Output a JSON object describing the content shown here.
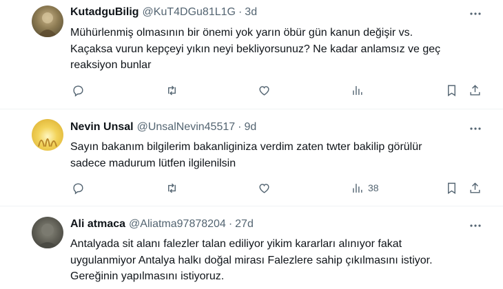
{
  "tweets": [
    {
      "name": "KutadguBilig",
      "handle": "@KuT4DGu81L1G",
      "dot": "·",
      "time": "3d",
      "lines": [
        "Mühürlenmiş olmasının bir önemi yok yarın öbür gün kanun değişir vs.",
        "Kaçaksa vurun kepçeyi yıkın neyi bekliyorsunuz? Ne kadar anlamsız ve geç",
        "reaksiyon bunlar"
      ],
      "views": ""
    },
    {
      "name": "Nevin Unsal",
      "handle": "@UnsalNevin45517",
      "dot": "·",
      "time": "9d",
      "lines": [
        "Sayın bakanım bilgilerim bakanliginiza verdim zaten twter bakilip görülür",
        "sadece madurum lütfen ilgilenilsin"
      ],
      "views": "38"
    },
    {
      "name": "Ali atmaca",
      "handle": "@Aliatma97878204",
      "dot": "·",
      "time": "27d",
      "lines": [
        "Antalyada sit alanı falezler talan ediliyor yikim kararları alınıyor fakat",
        "uygulanmiyor Antalya halkı doğal mirası Falezlere sahip çıkılmasını istiyor.",
        "Gereğinin yapılmasını istiyoruz."
      ],
      "views": ""
    }
  ],
  "icons": {
    "reply": "reply-icon",
    "retweet": "retweet-icon",
    "like": "like-icon",
    "views": "views-icon",
    "bookmark": "bookmark-icon",
    "share": "share-icon",
    "more": "more-icon"
  },
  "colors": {
    "text": "#0f1419",
    "secondary": "#536471",
    "divider": "#eff3f4"
  }
}
